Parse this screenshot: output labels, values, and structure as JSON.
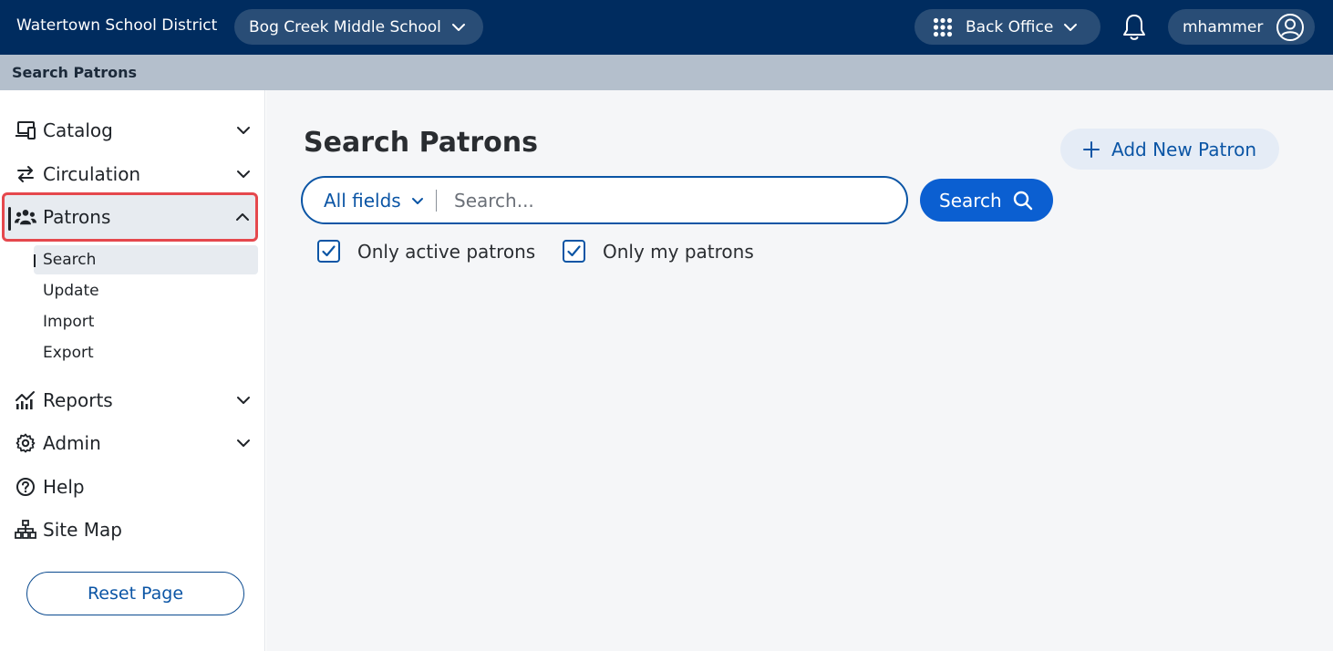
{
  "header": {
    "district": "Watertown School District",
    "school": "Bog Creek Middle School",
    "app_switcher": "Back Office",
    "username": "mhammer"
  },
  "breadcrumb": "Search Patrons",
  "sidebar": {
    "items": [
      {
        "label": "Catalog",
        "icon": "devices-icon",
        "expandable": true,
        "expanded": false
      },
      {
        "label": "Circulation",
        "icon": "arrows-swap-icon",
        "expandable": true,
        "expanded": false
      },
      {
        "label": "Patrons",
        "icon": "people-icon",
        "expandable": true,
        "expanded": true,
        "active": true
      },
      {
        "label": "Reports",
        "icon": "chart-icon",
        "expandable": true,
        "expanded": false
      },
      {
        "label": "Admin",
        "icon": "gear-icon",
        "expandable": true,
        "expanded": false
      },
      {
        "label": "Help",
        "icon": "help-icon",
        "expandable": false
      },
      {
        "label": "Site Map",
        "icon": "sitemap-icon",
        "expandable": false
      }
    ],
    "patron_subitems": [
      "Search",
      "Update",
      "Import",
      "Export"
    ],
    "active_subitem": "Search",
    "reset_label": "Reset Page"
  },
  "main": {
    "title": "Search Patrons",
    "add_label": "Add New Patron",
    "search": {
      "field": "All fields",
      "placeholder": "Search...",
      "value": "",
      "button": "Search"
    },
    "filters": [
      {
        "label": "Only active patrons",
        "checked": true
      },
      {
        "label": "Only my patrons",
        "checked": true
      }
    ]
  },
  "colors": {
    "topbar": "#002c5f",
    "accent": "#0b55a5",
    "primary_button": "#0b5fd1",
    "highlight_border": "#e5484d"
  }
}
